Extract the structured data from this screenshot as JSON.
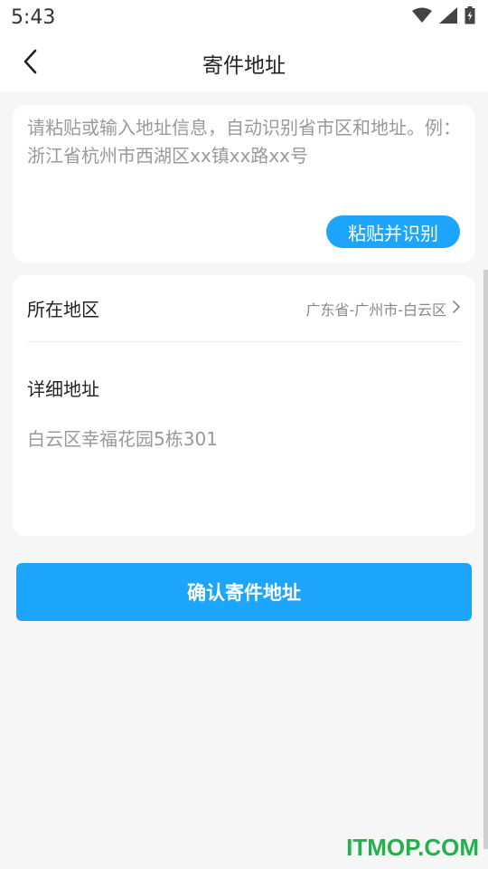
{
  "status_bar": {
    "time": "5:43",
    "icons": [
      "wifi-icon",
      "signal-icon",
      "battery-icon"
    ]
  },
  "nav": {
    "back_icon": "chevron-left-icon",
    "title": "寄件地址"
  },
  "paste_card": {
    "placeholder": "请粘贴或输入地址信息，自动识别省市区和地址。例：浙江省杭州市西湖区xx镇xx路xx号",
    "button_label": "粘贴并识别"
  },
  "address": {
    "region_label": "所在地区",
    "region_value": "广东省-广州市-白云区",
    "region_chevron": "chevron-right-icon",
    "detail_label": "详细地址",
    "detail_value": "白云区幸福花园5栋301"
  },
  "confirm_button": {
    "label": "确认寄件地址"
  },
  "watermark": "ITMOP.COM",
  "colors": {
    "accent": "#1da5fb",
    "background": "#f6f6f6",
    "card": "#ffffff",
    "watermark": "#22b14c"
  }
}
